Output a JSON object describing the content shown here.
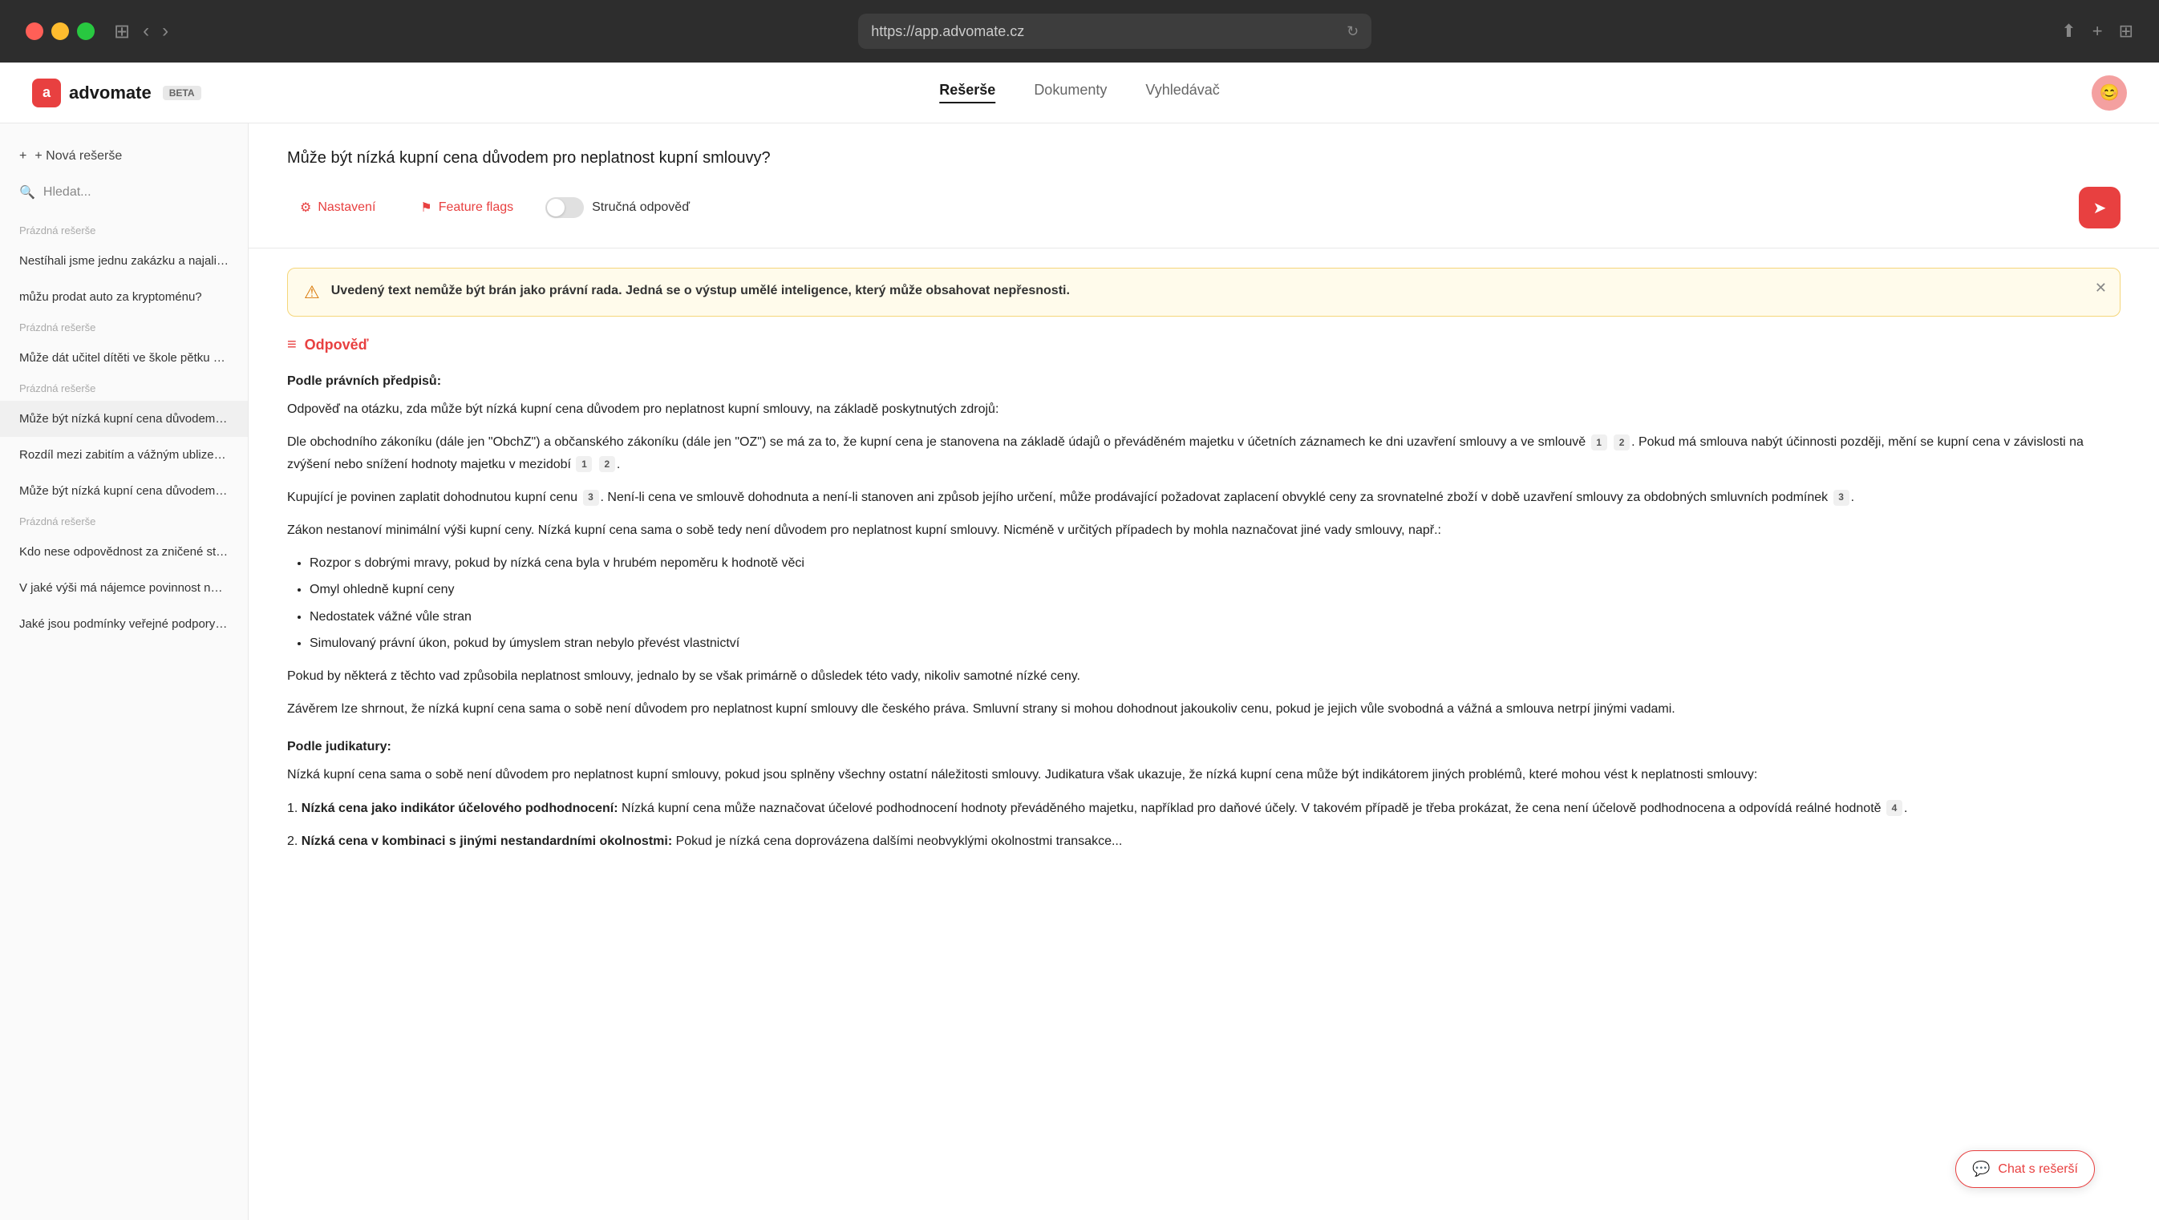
{
  "browser": {
    "url": "https://app.advomate.cz",
    "traffic_lights": [
      "red",
      "yellow",
      "green"
    ]
  },
  "header": {
    "logo_text": "advomate",
    "logo_badge": "BETA",
    "nav_items": [
      {
        "label": "Rešerše",
        "active": true
      },
      {
        "label": "Dokumenty",
        "active": false
      },
      {
        "label": "Vyhledávač",
        "active": false
      }
    ]
  },
  "sidebar": {
    "new_btn_label": "+ Nová rešerše",
    "search_placeholder": "Hledat...",
    "sections": [
      {
        "label": "Prázdná rešerše",
        "items": [
          "Nestíhali jsme jednu zakázku a najali jsm...",
          "můžu prodat auto za kryptoménu?"
        ]
      },
      {
        "label": "Prázdná rešerše",
        "items": [
          "Může dát učitel dítěti ve škole pětku za ..."
        ]
      },
      {
        "label": "Prázdná rešerše",
        "items": [
          "Může být nízká kupní cena důvodem pro...",
          "Rozdíl mezi zabitím a vážným ublizením ...",
          "Může být nízká kupní cena důvodem pro..."
        ]
      },
      {
        "label": "Prázdná rešerše",
        "items": [
          "Kdo nese odpovědnost za zničené stěny...",
          "V jaké výši má nájemce povinnost nést n...",
          "Jaké jsou podmínky veřejné podpory ma..."
        ]
      }
    ]
  },
  "toolbar": {
    "settings_label": "Nastavení",
    "feature_flags_label": "Feature flags",
    "toggle_label": "Stručná odpověď",
    "toggle_active": false
  },
  "question": {
    "text": "Může být nízká kupní cena důvodem pro neplatnost kupní smlouvy?"
  },
  "warning": {
    "text_bold": "Uvedený text nemůže být brán jako právní rada. Jedná se o výstup umělé inteligence, který může obsahovat nepřesnosti."
  },
  "answer": {
    "header_label": "Odpověď",
    "paragraphs": {
      "legal_basis_heading": "Podle právních předpisů:",
      "legal_intro": "Odpověď na otázku, zda může být nízká kupní cena důvodem pro neplatnost kupní smlouvy, na základě poskytnutých zdrojů:",
      "legal_p1": "Dle obchodního zákoníku (dále jen \"ObchZ\") a občanského zákoníku (dále jen \"OZ\") se má za to, že kupní cena je stanovena na základě údajů o převáděném majetku v účetních záznamech ke dni uzavření smlouvy a ve smlouvě",
      "legal_p1_suffix": ". Pokud má smlouva nabýt účinnosti později, mění se kupní cena v závislosti na zvýšení nebo snížení hodnoty majetku v mezidobí",
      "legal_p2": "Kupující je povinen zaplatit dohodnutou kupní cenu",
      "legal_p2_suffix": ". Není-li cena ve smlouvě dohodnuta a není-li stanoven ani způsob jejího určení, může prodávající požadovat zaplacení obvyklé ceny za srovnatelné zboží v době uzavření smlouvy za obdobných smluvních podmínek",
      "legal_p3": "Zákon nestanoví minimální výši kupní ceny. Nízká kupní cena sama o sobě tedy není důvodem pro neplatnost kupní smlouvy. Nicméně v určitých případech by mohla naznačovat jiné vady smlouvy, např.:",
      "legal_bullets": [
        "Rozpor s dobrými mravy, pokud by nízká cena byla v hrubém nepoměru k hodnotě věci",
        "Omyl ohledně kupní ceny",
        "Nedostatek vážné vůle stran",
        "Simulovaný právní úkon, pokud by úmyslem stran nebylo převést vlastnictví"
      ],
      "legal_p4": "Pokud by některá z těchto vad způsobila neplatnost smlouvy, jednalo by se však primárně o důsledek této vady, nikoliv samotné nízké ceny.",
      "legal_p5": "Závěrem lze shrnout, že nízká kupní cena sama o sobě není důvodem pro neplatnost kupní smlouvy dle českého práva. Smluvní strany si mohou dohodnout jakoukoliv cenu, pokud je jejich vůle svobodná a vážná a smlouva netrpí jinými vadami.",
      "case_law_heading": "Podle judikatury:",
      "case_intro": "Nízká kupní cena sama o sobě není důvodem pro neplatnost kupní smlouvy, pokud jsou splněny všechny ostatní náležitosti smlouvy. Judikatura však ukazuje, že nízká kupní cena může být indikátorem jiných problémů, které mohou vést k neplatnosti smlouvy:",
      "case_bullets": [
        {
          "label": "Nízká cena jako indikátor účelového podhodnocení:",
          "text": "Nízká kupní cena může naznačovat účelové podhodnocení hodnoty převáděného majetku, například pro daňové účely. V takovém případě je třeba prokázat, že cena není účelově podhodnocena a odpovídá reálné hodnotě"
        },
        {
          "label": "Nízká cena v kombinaci s jinými nestandardními okolnostmi:",
          "text": "Pokud je nízká cena doprovázena dalšími neobvyklými okolnostmi transakce..."
        }
      ]
    }
  },
  "chat_btn": {
    "label": "Chat s rešerší"
  }
}
